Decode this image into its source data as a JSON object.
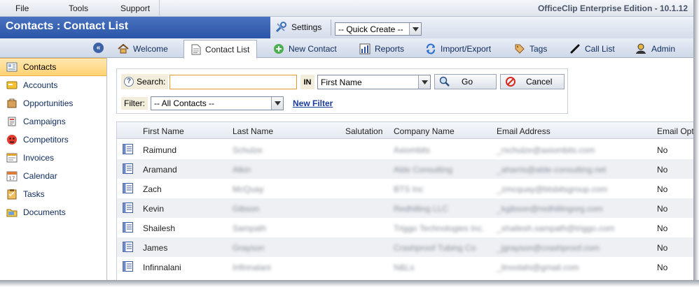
{
  "menu": {
    "items": [
      "File",
      "Tools",
      "Support"
    ],
    "edition": "OfficeClip Enterprise Edition - 10.1.12"
  },
  "title": "Contacts : Contact List",
  "toolbar": {
    "settings_label": "Settings",
    "quick_create": "-- Quick Create --"
  },
  "tabs": [
    {
      "label": "Welcome",
      "icon": "home-icon"
    },
    {
      "label": "Contact List",
      "icon": "document-icon",
      "active": true
    },
    {
      "label": "New Contact",
      "icon": "plus-icon"
    },
    {
      "label": "Reports",
      "icon": "chart-icon"
    },
    {
      "label": "Import/Export",
      "icon": "sync-icon"
    },
    {
      "label": "Tags",
      "icon": "tag-icon"
    },
    {
      "label": "Call List",
      "icon": "phone-icon"
    },
    {
      "label": "Admin",
      "icon": "admin-icon"
    }
  ],
  "sidebar": {
    "collapse": "«",
    "items": [
      {
        "label": "Contacts",
        "icon": "contacts-icon",
        "active": true
      },
      {
        "label": "Accounts",
        "icon": "accounts-icon"
      },
      {
        "label": "Opportunities",
        "icon": "opportunities-icon"
      },
      {
        "label": "Campaigns",
        "icon": "campaigns-icon"
      },
      {
        "label": "Competitors",
        "icon": "competitors-icon"
      },
      {
        "label": "Invoices",
        "icon": "invoices-icon"
      },
      {
        "label": "Calendar",
        "icon": "calendar-icon"
      },
      {
        "label": "Tasks",
        "icon": "tasks-icon"
      },
      {
        "label": "Documents",
        "icon": "documents-icon"
      }
    ]
  },
  "search": {
    "label": "Search:",
    "value": "",
    "in_label": "IN",
    "field": "First Name",
    "go": "Go",
    "cancel": "Cancel",
    "filter_label": "Filter:",
    "filter_value": "-- All Contacts --",
    "new_filter": "New Filter"
  },
  "grid": {
    "columns": [
      "First Name",
      "Last Name",
      "Salutation",
      "Company Name",
      "Email Address",
      "Email Opt"
    ],
    "rows": [
      {
        "first": "Raimund",
        "last": "Schulze",
        "salutation": "",
        "company": "Axiombits",
        "email": "_rschulze@axiombits.com",
        "opt": "No"
      },
      {
        "first": "Aramand",
        "last": "Alkin",
        "salutation": "",
        "company": "Alde Consulting",
        "email": "_aharris@alde-consulting.net",
        "opt": "No"
      },
      {
        "first": "Zach",
        "last": "McQuay",
        "salutation": "",
        "company": "BTS Inc",
        "email": "_zmcquay@btsbitsgroup.com",
        "opt": "No"
      },
      {
        "first": "Kevin",
        "last": "Gibson",
        "salutation": "",
        "company": "Redhilling LLC",
        "email": "_kgibson@redhillingorg.com",
        "opt": "No"
      },
      {
        "first": "Shailesh",
        "last": "Sampath",
        "salutation": "",
        "company": "Triggo Technologies Inc.",
        "email": "_shailesh.sampath@triggo.com",
        "opt": "No"
      },
      {
        "first": "James",
        "last": "Grayson",
        "salutation": "",
        "company": "Crashproof Tubing Co",
        "email": "_jgrayson@crashproof.com",
        "opt": "No"
      },
      {
        "first": "Infinnalani",
        "last": "Infinnalani",
        "salutation": "",
        "company": "N&Ls",
        "email": "_linoolahi@gmail.com",
        "opt": "No"
      }
    ]
  }
}
